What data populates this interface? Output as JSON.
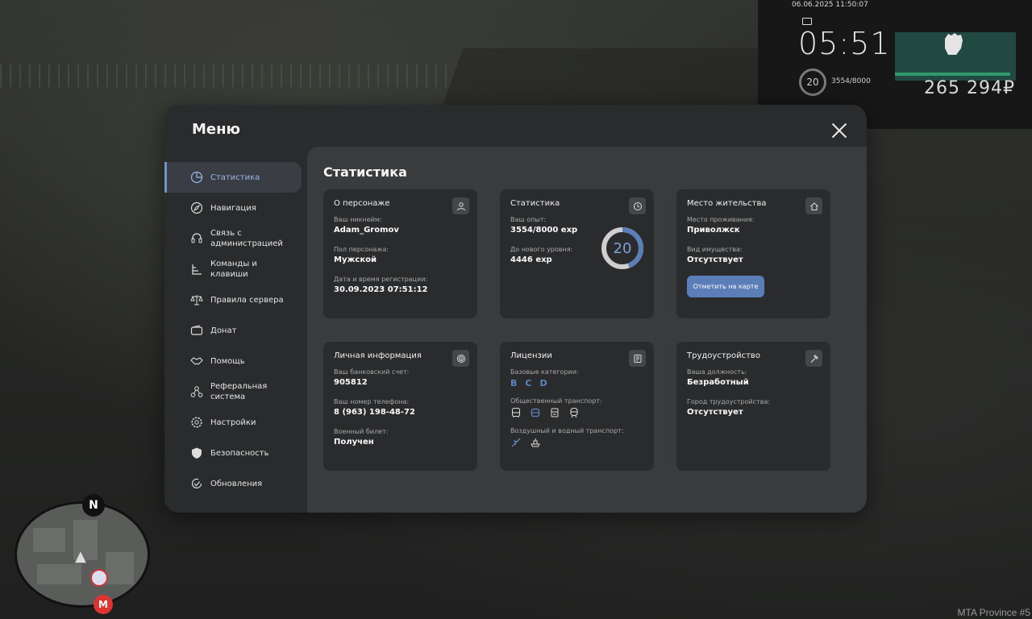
{
  "hud": {
    "datetime": "06.06.2025 11:50:07",
    "time": "05:51",
    "level": "20",
    "exp": "3554/8000",
    "money": "265 294₽"
  },
  "minimap": {
    "north": "N",
    "metro": "M"
  },
  "watermark": "MTA Province #5",
  "modal": {
    "title": "Меню",
    "content_title": "Статистика"
  },
  "sidebar": {
    "items": [
      {
        "label": "Статистика",
        "icon": "pie-chart-icon"
      },
      {
        "label": "Навигация",
        "icon": "compass-icon"
      },
      {
        "label": "Связь с администрацией",
        "icon": "headset-icon"
      },
      {
        "label": "Команды и клавиши",
        "icon": "commands-icon"
      },
      {
        "label": "Правила сервера",
        "icon": "scales-icon"
      },
      {
        "label": "Донат",
        "icon": "wallet-icon"
      },
      {
        "label": "Помощь",
        "icon": "handshake-icon"
      },
      {
        "label": "Реферальная система",
        "icon": "referral-icon"
      },
      {
        "label": "Настройки",
        "icon": "gear-icon"
      },
      {
        "label": "Безопасность",
        "icon": "shield-icon"
      },
      {
        "label": "Обновления",
        "icon": "refresh-icon"
      }
    ]
  },
  "cards": {
    "character": {
      "title": "О персонаже",
      "nick_label": "Ваш никнейм:",
      "nick": "Adam_Gromov",
      "gender_label": "Пол персонажа:",
      "gender": "Мужской",
      "reg_label": "Дата и время регистрации:",
      "reg": "30.09.2023 07:51:12"
    },
    "stats": {
      "title": "Статистика",
      "exp_label": "Ваш опыт:",
      "exp": "3554/8000 exp",
      "next_label": "До нового уровня:",
      "next": "4446 exp",
      "level": "20",
      "progress": 0.44425
    },
    "residence": {
      "title": "Место жительства",
      "place_label": "Место проживания:",
      "place": "Приволжск",
      "property_label": "Вид имущества:",
      "property": "Отсутствует",
      "button": "Отметить на карте"
    },
    "personal": {
      "title": "Личная информация",
      "bank_label": "Ваш банковский счет:",
      "bank": "905812",
      "phone_label": "Ваш номер телефона:",
      "phone": "8 (963) 198-48-72",
      "military_label": "Военный билет:",
      "military": "Получен"
    },
    "licenses": {
      "title": "Лицензии",
      "base_label": "Базовые категории:",
      "categories": [
        "B",
        "C",
        "D"
      ],
      "public_label": "Общественный транспорт:",
      "air_label": "Воздушный и водный транспорт:"
    },
    "employment": {
      "title": "Трудоустройство",
      "position_label": "Ваша должность:",
      "position": "Безработный",
      "city_label": "Город трудоустройства:",
      "city": "Отсутствует"
    }
  },
  "colors": {
    "accent": "#5b7db8",
    "panel": "#2a2b2d",
    "content": "#3a3b3d",
    "hud_bar": "#2f9a6b"
  }
}
